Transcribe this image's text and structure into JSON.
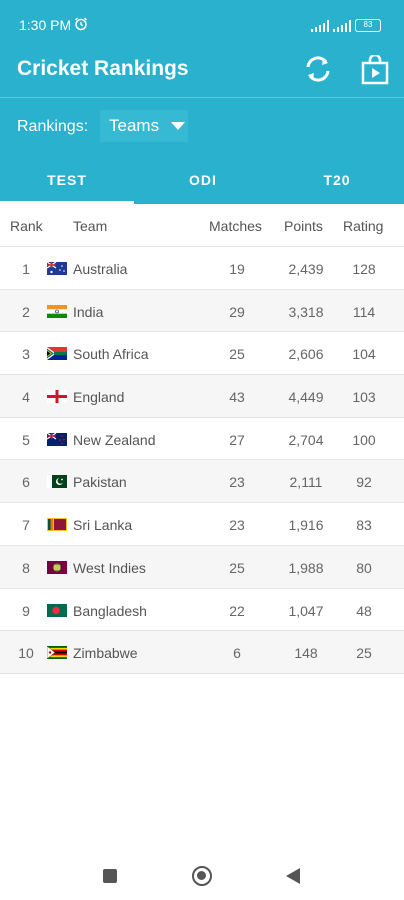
{
  "status_bar": {
    "time": "1:30 PM",
    "battery": "83"
  },
  "header": {
    "title": "Cricket Rankings",
    "rankings_label": "Rankings:",
    "rankings_selected": "Teams"
  },
  "tabs": [
    {
      "label": "TEST",
      "active": true
    },
    {
      "label": "ODI",
      "active": false
    },
    {
      "label": "T20",
      "active": false
    }
  ],
  "table": {
    "columns": {
      "rank": "Rank",
      "team": "Team",
      "matches": "Matches",
      "points": "Points",
      "rating": "Rating"
    },
    "rows": [
      {
        "rank": "1",
        "team": "Australia",
        "matches": "19",
        "points": "2,439",
        "rating": "128",
        "flag": "australia-flag-icon"
      },
      {
        "rank": "2",
        "team": "India",
        "matches": "29",
        "points": "3,318",
        "rating": "114",
        "flag": "india-flag-icon"
      },
      {
        "rank": "3",
        "team": "South Africa",
        "matches": "25",
        "points": "2,606",
        "rating": "104",
        "flag": "south-africa-flag-icon"
      },
      {
        "rank": "4",
        "team": "England",
        "matches": "43",
        "points": "4,449",
        "rating": "103",
        "flag": "england-flag-icon"
      },
      {
        "rank": "5",
        "team": "New Zealand",
        "matches": "27",
        "points": "2,704",
        "rating": "100",
        "flag": "new-zealand-flag-icon"
      },
      {
        "rank": "6",
        "team": "Pakistan",
        "matches": "23",
        "points": "2,111",
        "rating": "92",
        "flag": "pakistan-flag-icon"
      },
      {
        "rank": "7",
        "team": "Sri Lanka",
        "matches": "23",
        "points": "1,916",
        "rating": "83",
        "flag": "sri-lanka-flag-icon"
      },
      {
        "rank": "8",
        "team": "West Indies",
        "matches": "25",
        "points": "1,988",
        "rating": "80",
        "flag": "west-indies-flag-icon"
      },
      {
        "rank": "9",
        "team": "Bangladesh",
        "matches": "22",
        "points": "1,047",
        "rating": "48",
        "flag": "bangladesh-flag-icon"
      },
      {
        "rank": "10",
        "team": "Zimbabwe",
        "matches": "6",
        "points": "148",
        "rating": "25",
        "flag": "zimbabwe-flag-icon"
      }
    ]
  },
  "colors": {
    "primary": "#29b1cd",
    "accent_dark": "#36bad4",
    "text": "#666666",
    "row_alt": "#f6f6f6"
  },
  "nav": {
    "recents": "square-icon",
    "home": "circle-icon",
    "back": "triangle-back-icon"
  }
}
